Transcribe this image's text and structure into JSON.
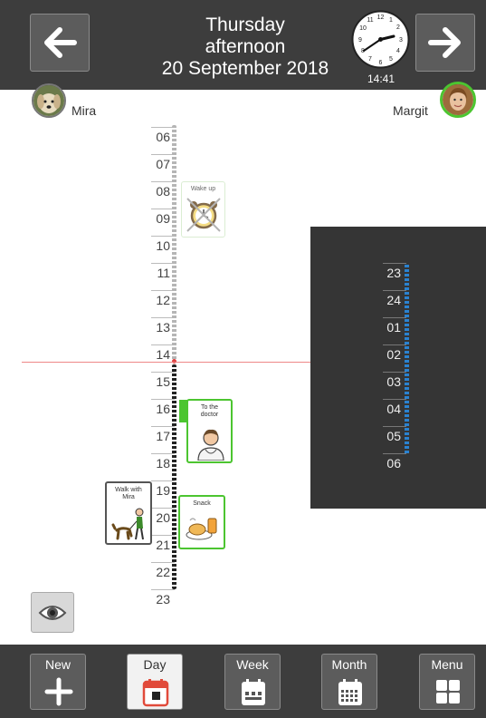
{
  "header": {
    "day": "Thursday",
    "period": "afternoon",
    "date": "20 September 2018",
    "clock_time": "14:41",
    "prev_icon": "arrow-left-icon",
    "next_icon": "arrow-right-icon"
  },
  "people": {
    "left": {
      "name": "Mira",
      "avatar": "dog-photo"
    },
    "right": {
      "name": "Margit",
      "avatar": "woman-photo"
    }
  },
  "timeline_main": {
    "hours": [
      "06",
      "07",
      "08",
      "09",
      "10",
      "11",
      "12",
      "13",
      "14",
      "15",
      "16",
      "17",
      "18",
      "19",
      "20",
      "21",
      "22",
      "23"
    ],
    "current_hour": "14"
  },
  "timeline_right": {
    "hours": [
      "23",
      "24",
      "01",
      "02",
      "03",
      "04",
      "05",
      "06"
    ]
  },
  "activities": [
    {
      "label": "Wake up",
      "icon": "alarm-clock-icon",
      "state": "done"
    },
    {
      "label": "To the doctor",
      "icon": "doctor-icon",
      "state": "upcoming"
    },
    {
      "label": "Snack",
      "icon": "snack-icon",
      "state": "upcoming"
    },
    {
      "label": "Walk with Mira",
      "icon": "dog-walk-icon",
      "state": "other-person"
    }
  ],
  "toolbar": {
    "new_label": "New",
    "day_label": "Day",
    "week_label": "Week",
    "month_label": "Month",
    "menu_label": "Menu",
    "active": "Day"
  },
  "colors": {
    "header_bg": "#3d3d3d",
    "accent_green": "#4cc530",
    "now_line": "#e88888",
    "night_dots": "#2a82d0"
  }
}
